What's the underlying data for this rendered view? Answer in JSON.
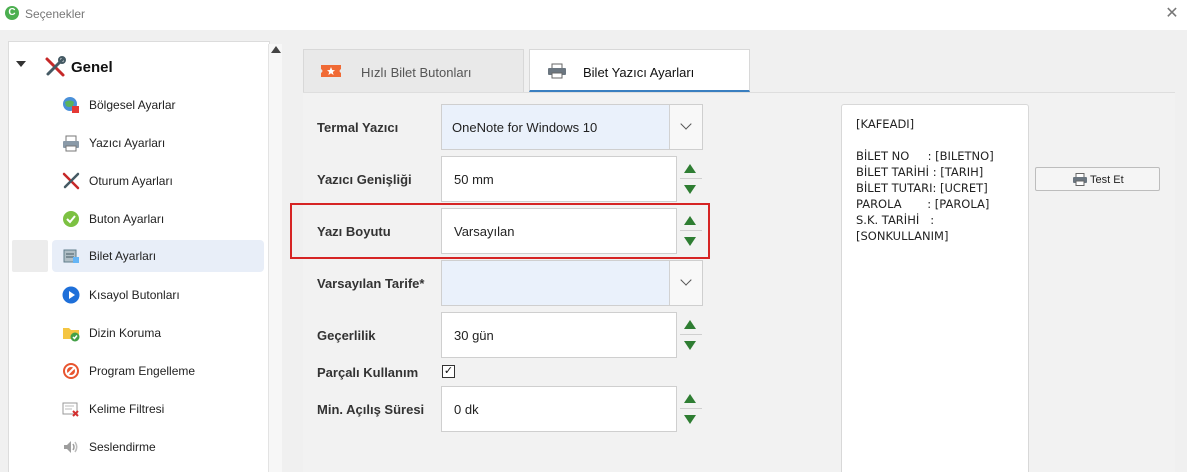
{
  "window": {
    "title": "Seçenekler",
    "logo_letter": "C"
  },
  "sidebar": {
    "group_label": "Genel",
    "items": [
      {
        "label": "Bölgesel Ayarlar",
        "icon": "globe-icon"
      },
      {
        "label": "Yazıcı Ayarları",
        "icon": "printer-icon"
      },
      {
        "label": "Oturum Ayarları",
        "icon": "tools-icon"
      },
      {
        "label": "Buton Ayarları",
        "icon": "check-circle-icon"
      },
      {
        "label": "Bilet Ayarları",
        "icon": "ticket-icon",
        "selected": true
      },
      {
        "label": "Kısayol Butonları",
        "icon": "play-icon"
      },
      {
        "label": "Dizin Koruma",
        "icon": "folder-shield-icon"
      },
      {
        "label": "Program Engelleme",
        "icon": "block-icon"
      },
      {
        "label": "Kelime Filtresi",
        "icon": "filter-icon"
      },
      {
        "label": "Seslendirme",
        "icon": "speaker-icon"
      }
    ]
  },
  "tabs": [
    {
      "label": "Hızlı Bilet Butonları",
      "icon": "ticket-star-icon",
      "active": false
    },
    {
      "label": "Bilet Yazıcı Ayarları",
      "icon": "printer-icon",
      "active": true
    }
  ],
  "form": {
    "termal_yazici": {
      "label": "Termal Yazıcı",
      "value": "OneNote for Windows 10"
    },
    "yazici_genisligi": {
      "label": "Yazıcı Genişliği",
      "value": "50 mm"
    },
    "yazi_boyutu": {
      "label": "Yazı Boyutu",
      "value": "Varsayılan"
    },
    "varsayilan_tarife": {
      "label": "Varsayılan Tarife*",
      "value": ""
    },
    "gecerlilik": {
      "label": "Geçerlilik",
      "value": "30 gün"
    },
    "parcali_kullanim": {
      "label": "Parçalı Kullanım",
      "checked": true,
      "mark": "✓"
    },
    "min_acilis_suresi": {
      "label": "Min. Açılış Süresi",
      "value": "0 dk"
    }
  },
  "preview": {
    "lines": [
      "[KAFEADI]",
      "",
      "BİLET NO     : [BILETNO]",
      "BİLET TARİHİ : [TARIH]",
      "BİLET TUTARI: [UCRET]",
      "PAROLA       : [PAROLA]",
      "S.K. TARİHİ   :",
      "[SONKULLANIM]"
    ]
  },
  "test_button": {
    "label": "Test Et"
  },
  "colors": {
    "accent": "#3a7fc0",
    "highlight": "#d62424",
    "spin": "#2e7d32"
  }
}
